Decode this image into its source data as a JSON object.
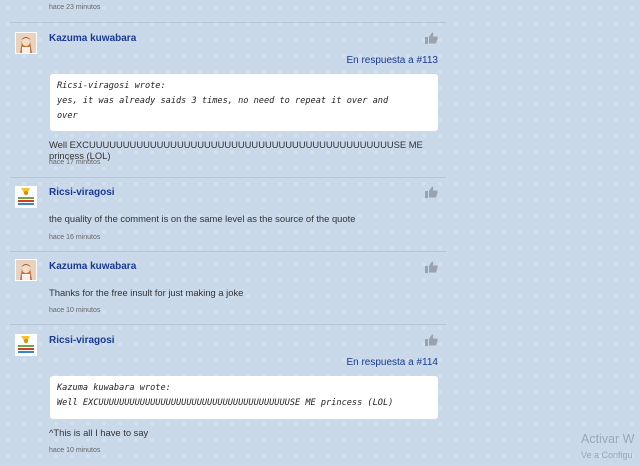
{
  "comments": [
    {
      "time": "hace 23 minutos"
    },
    {
      "author": "Kazuma kuwabara",
      "reply": "En respuesta a #113",
      "quote": [
        "Ricsi-viragosi wrote:",
        "yes, it was already saids 3 times, no need to repeat it over and",
        "over"
      ],
      "body": "Well EXCUUUUUUUUUUUUUUUUUUUUUUUUUUUUUUUUUUUUUUUUUUUUUSE ME princess (LOL)",
      "time": "hace 17 minutos"
    },
    {
      "author": "Ricsi-viragosi",
      "body": "the quality of the comment is on the same level as the source of the quote",
      "time": "hace 16 minutos"
    },
    {
      "author": "Kazuma kuwabara",
      "body": "Thanks for the free insult for just making a joke",
      "time": "hace 10 minutos"
    },
    {
      "author": "Ricsi-viragosi",
      "reply": "En respuesta a #114",
      "quote": [
        "Kazuma kuwabara wrote:",
        "Well EXCUUUUUUUUUUUUUUUUUUUUUUUUUUUUUUUUUUUUUSE ME princess (LOL)"
      ],
      "body": "^This is all I have to say",
      "time": "hace 10 minutos"
    }
  ],
  "watermark": {
    "title": "Activar W",
    "subtitle": "Ve a Configu"
  },
  "icons": {
    "like": "thumbs-up-icon",
    "avatar_kazuma": "avatar-kazuma",
    "avatar_ricsi": "avatar-ricsi"
  },
  "colors": {
    "author": "#1a3a8f",
    "background": "#c9d9ea",
    "quote_bg": "#ffffff"
  }
}
